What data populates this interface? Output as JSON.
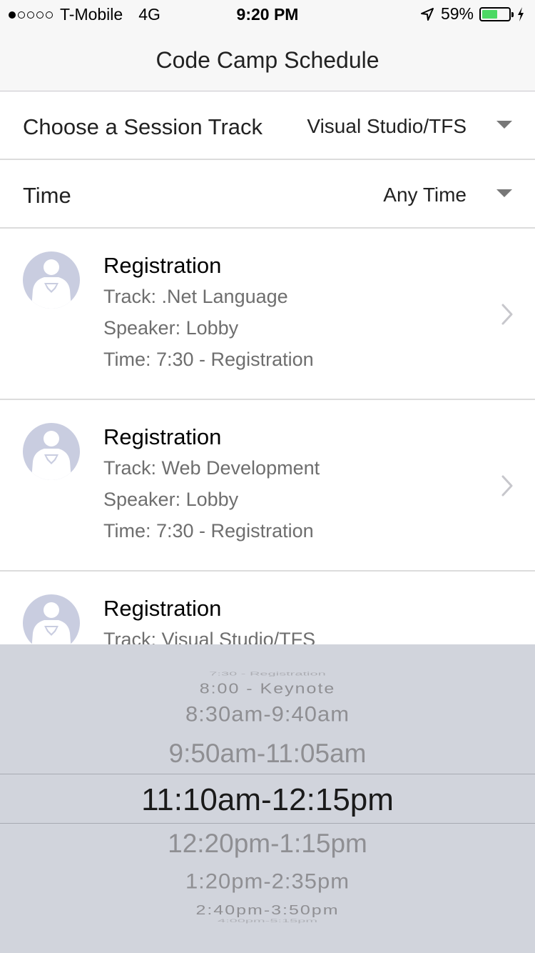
{
  "status_bar": {
    "carrier": "T-Mobile",
    "network": "4G",
    "time": "9:20 PM",
    "battery_percent_label": "59%",
    "battery_level": 0.59,
    "signal_bars_filled": 1,
    "signal_bars_total": 5,
    "battery_color": "#4cd964"
  },
  "nav": {
    "title": "Code Camp Schedule"
  },
  "filters": {
    "track": {
      "label": "Choose a Session Track",
      "value": "Visual Studio/TFS"
    },
    "time": {
      "label": "Time",
      "value": "Any Time"
    }
  },
  "sessions": [
    {
      "title": "Registration",
      "track": "Track: .Net Language",
      "speaker": "Speaker: Lobby",
      "time": "Time: 7:30 - Registration"
    },
    {
      "title": "Registration",
      "track": "Track: Web Development",
      "speaker": "Speaker: Lobby",
      "time": "Time: 7:30 - Registration"
    },
    {
      "title": "Registration",
      "track": "Track: Visual Studio/TFS"
    }
  ],
  "picker": {
    "options": [
      "7:30 - Registration",
      "8:00 - Keynote",
      "8:30am-9:40am",
      "9:50am-11:05am",
      "11:10am-12:15pm",
      "12:20pm-1:15pm",
      "1:20pm-2:35pm",
      "2:40pm-3:50pm",
      "4:00pm-5:15pm"
    ],
    "selected": "11:10am-12:15pm"
  }
}
